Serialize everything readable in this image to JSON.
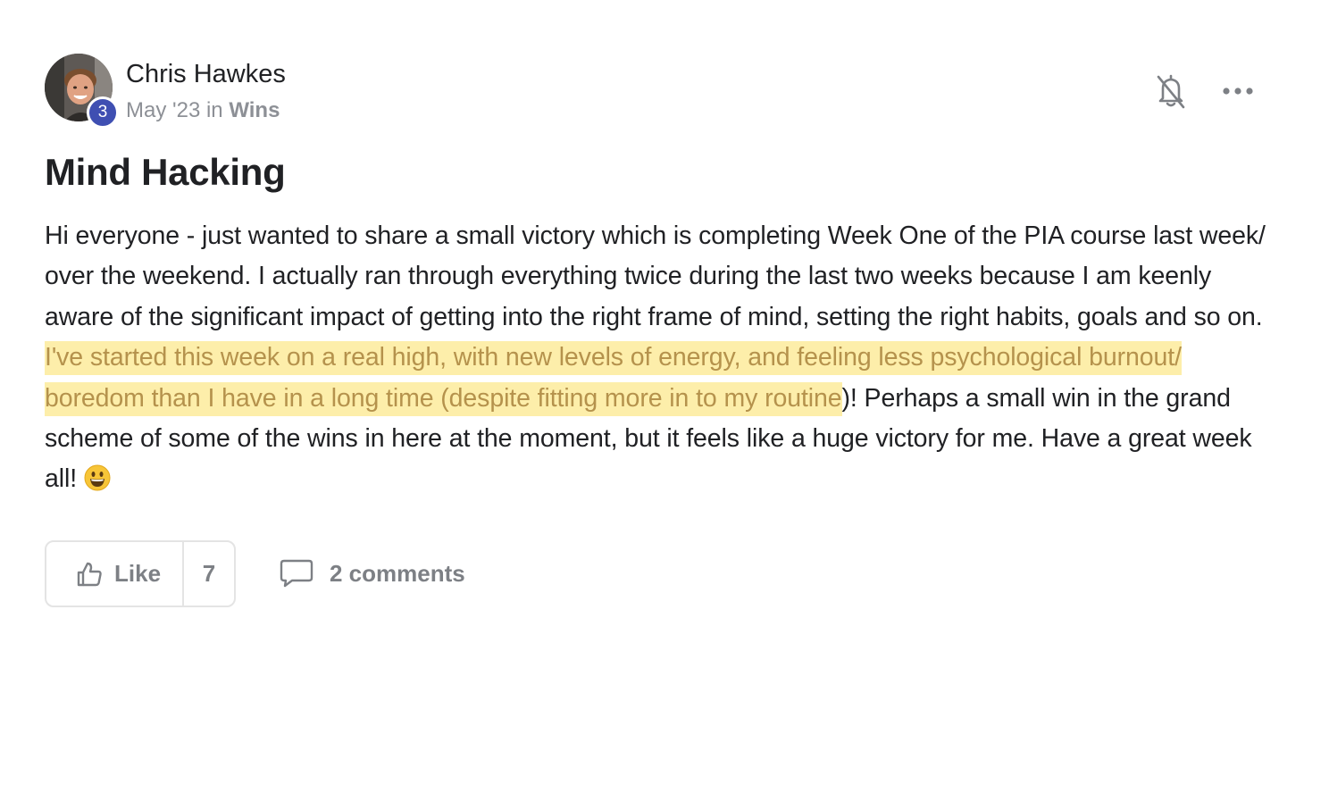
{
  "post": {
    "author": {
      "name": "Chris Hawkes",
      "level": "3",
      "avatar": "profile-photo"
    },
    "meta": {
      "date": "May '23",
      "in_word": " in ",
      "category": "Wins"
    },
    "title": "Mind Hacking",
    "body": {
      "part1": "Hi everyone - just wanted to share a small victory which is completing Week One of the PIA course last week/ over the weekend. I actually ran through everything twice during the last two weeks because I am keenly aware of the significant impact of getting into the right frame of mind, setting the right habits, goals and so on. ",
      "highlighted": "I've started this week on a real high, with new levels of energy, and feeling less psychological burnout/ boredom than I have in a long time (despite fitting more in to my routine",
      "part2": ")! Perhaps a small win in the grand scheme of some of the wins in here at the moment, but it feels like a huge victory for me. Have a great week all! ",
      "emoji": "grinning-face"
    },
    "actions": {
      "like_label": "Like",
      "like_count": "7",
      "comments_label": "2 comments"
    },
    "icons": {
      "bell": "bell-off-icon",
      "more": "more-horizontal-icon",
      "like": "thumbs-up-icon",
      "comment": "comment-icon"
    },
    "colors": {
      "highlight_bg": "#fdeeaa",
      "highlight_text": "#b5924c",
      "badge": "#3f4fb2",
      "muted_text": "#8d9096"
    }
  }
}
